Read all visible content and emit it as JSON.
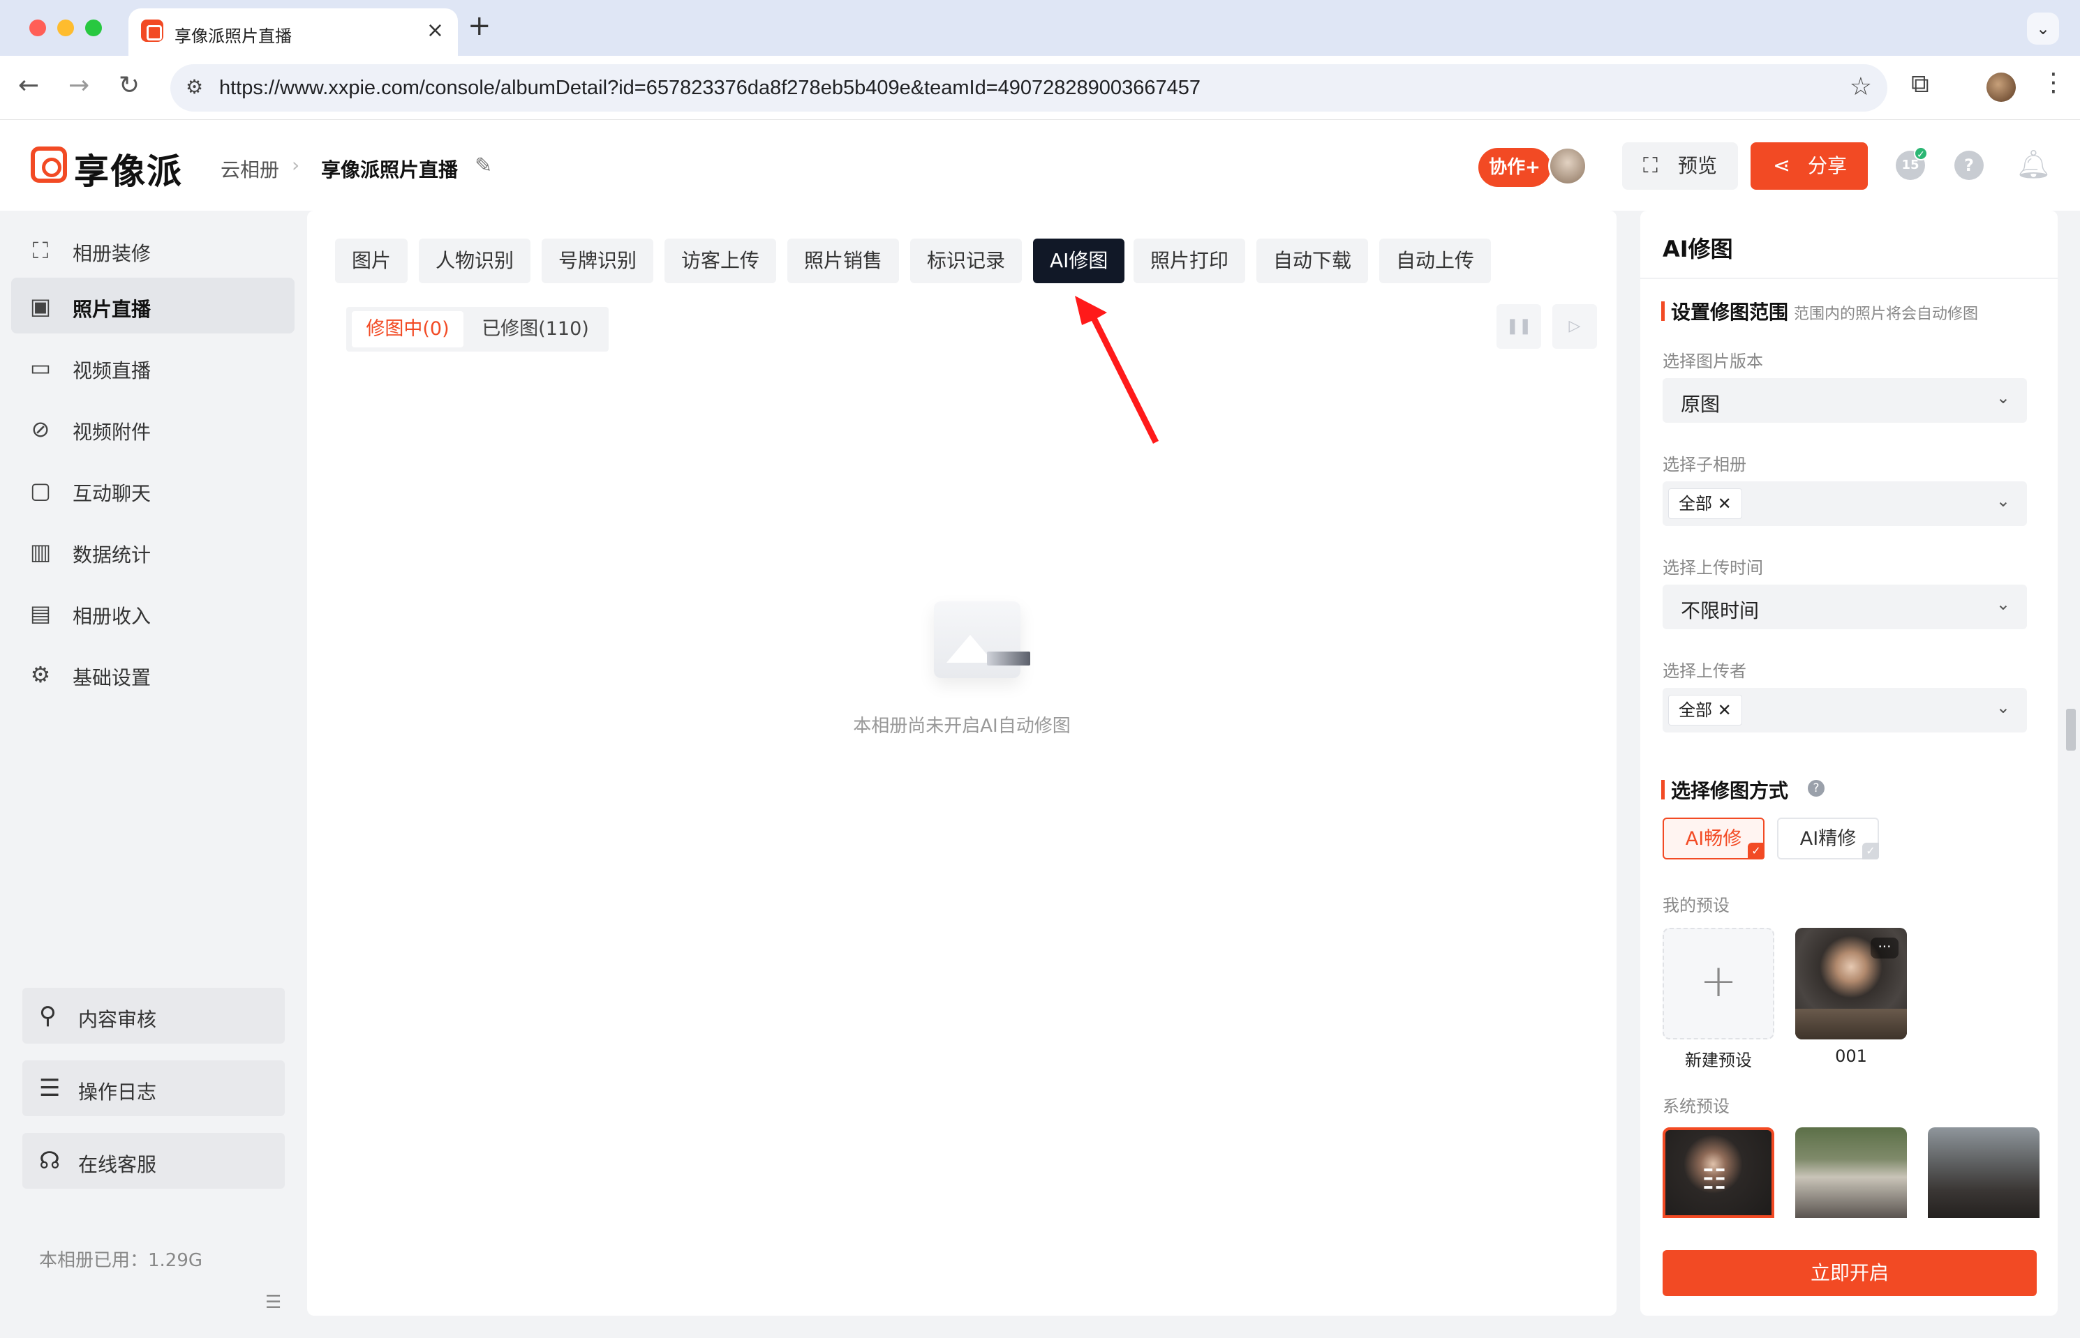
{
  "browser": {
    "tab_title": "享像派照片直播",
    "url": "https://www.xxpie.com/console/albumDetail?id=657823376da8f278eb5b409e&teamId=490728289003667457",
    "icons": [
      "back-icon",
      "forward-icon",
      "reload-icon",
      "site-settings-icon",
      "star-icon",
      "extensions-icon",
      "profile-avatar",
      "menu-icon"
    ]
  },
  "header": {
    "logo_text": "享像派",
    "breadcrumb": [
      "云相册",
      "享像派照片直播"
    ],
    "collab_label": "协作+",
    "preview_label": "预览",
    "share_label": "分享",
    "user_badge": "15",
    "help_glyph": "?"
  },
  "sidebar": {
    "items": [
      {
        "label": "相册装修",
        "icon": "decorate-icon"
      },
      {
        "label": "照片直播",
        "icon": "photo-icon",
        "active": true
      },
      {
        "label": "视频直播",
        "icon": "video-icon"
      },
      {
        "label": "视频附件",
        "icon": "attachment-icon"
      },
      {
        "label": "互动聊天",
        "icon": "chat-icon"
      },
      {
        "label": "数据统计",
        "icon": "stats-icon"
      },
      {
        "label": "相册收入",
        "icon": "income-icon"
      },
      {
        "label": "基础设置",
        "icon": "settings-icon"
      }
    ],
    "bottom": [
      {
        "label": "内容审核",
        "icon": "audit-icon"
      },
      {
        "label": "操作日志",
        "icon": "log-icon"
      },
      {
        "label": "在线客服",
        "icon": "headset-icon"
      }
    ],
    "usage": "本相册已用：1.29G"
  },
  "main": {
    "tabs": [
      "图片",
      "人物识别",
      "号牌识别",
      "访客上传",
      "照片销售",
      "标识记录",
      "AI修图",
      "照片打印",
      "自动下载",
      "自动上传"
    ],
    "active_tab": "AI修图",
    "subtabs": [
      "修图中(0)",
      "已修图(110)"
    ],
    "empty_text": "本相册尚未开启AI自动修图"
  },
  "panel": {
    "title": "AI修图",
    "section1": {
      "title": "设置修图范围",
      "hint": "范围内的照片将会自动修图"
    },
    "fields": [
      {
        "label": "选择图片版本",
        "value": "原图",
        "chip": false
      },
      {
        "label": "选择子相册",
        "value": "全部",
        "chip": true
      },
      {
        "label": "选择上传时间",
        "value": "不限时间",
        "chip": false
      },
      {
        "label": "选择上传者",
        "value": "全部",
        "chip": true
      }
    ],
    "section2": {
      "title": "选择修图方式"
    },
    "modes": [
      "AI畅修",
      "AI精修"
    ],
    "selected_mode": "AI畅修",
    "my_presets_label": "我的预设",
    "new_preset_label": "新建预设",
    "preset_001": "001",
    "system_presets_label": "系统预设",
    "start_label": "立即开启"
  },
  "colors": {
    "accent": "#f24a24",
    "active_tab_bg": "#111827",
    "page_bg": "#f2f3f5"
  }
}
